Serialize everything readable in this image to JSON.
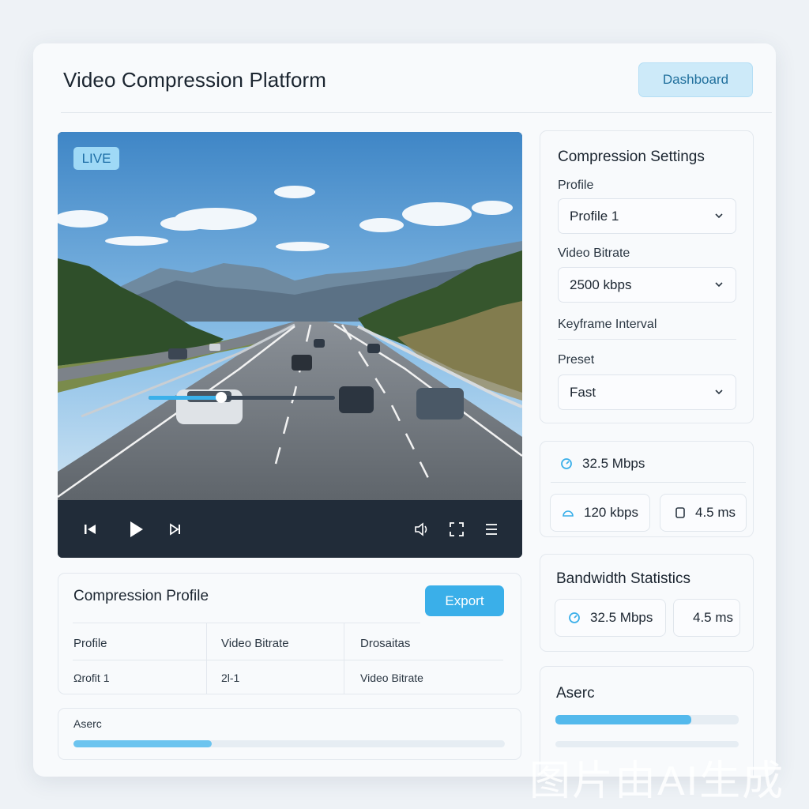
{
  "header": {
    "title": "Video Compression Platform",
    "dashboard_label": "Dashboard"
  },
  "video": {
    "live_label": "LIVE",
    "progress": 0.39,
    "controls": [
      "skip-back-icon",
      "play-icon",
      "skip-forward-icon",
      "volume-icon",
      "fullscreen-icon",
      "menu-icon"
    ]
  },
  "settings": {
    "title": "Compression Settings",
    "profile_label": "Profile",
    "profile_value": "Profile 1",
    "bitrate_label": "Video Bitrate",
    "bitrate_value": "2500 kbps",
    "keyframe_label": "Keyframe Interval",
    "preset_label": "Preset",
    "preset_value": "Fast"
  },
  "metrics": {
    "throughput": "32.5 Mbps",
    "bitrate": "120 kbps",
    "latency": "4.5 ms"
  },
  "bandwidth": {
    "title": "Bandwidth Statistics",
    "throughput": "32.5 Mbps",
    "latency": "4.5 ms"
  },
  "right_bottom": {
    "title": "Aserc",
    "bar1": 0.74,
    "bar2": 0.0
  },
  "profile_table": {
    "title": "Compression Profile",
    "export_label": "Export",
    "headers": [
      "Profile",
      "Video Bitrate",
      "Drosaitas"
    ],
    "row": [
      "Ωrofit 1",
      "2l-1",
      "Video Bitrate"
    ]
  },
  "left_bottom": {
    "title": "Aserc",
    "progress": 0.32
  },
  "watermark": "图片由AI生成",
  "colors": {
    "accent": "#3aafe9",
    "accent_light": "#cdeaf9",
    "player_bar": "#212c39"
  }
}
